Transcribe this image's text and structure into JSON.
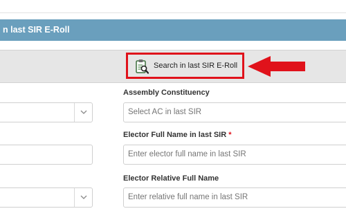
{
  "header": {
    "title": "n last SIR E-Roll"
  },
  "search_button": {
    "label": "Search in last SIR E-Roll",
    "icon": "clipboard-search-icon"
  },
  "pointer": {
    "icon": "red-arrow-left-icon",
    "color": "#e0121b"
  },
  "form": {
    "assembly_constituency": {
      "label": "Assembly Constituency",
      "placeholder": "Select AC in last SIR"
    },
    "elector_full_name": {
      "label": "Elector Full Name in last SIR",
      "required_mark": "*",
      "placeholder": "Enter elector full name in last SIR"
    },
    "elector_relative_full_name": {
      "label": "Elector Relative Full Name",
      "placeholder": "Enter relative full name in last SIR"
    }
  },
  "colors": {
    "header_bg": "#6a9fbd",
    "accent_red": "#e0121b",
    "band_bg": "#e6e6e6"
  }
}
